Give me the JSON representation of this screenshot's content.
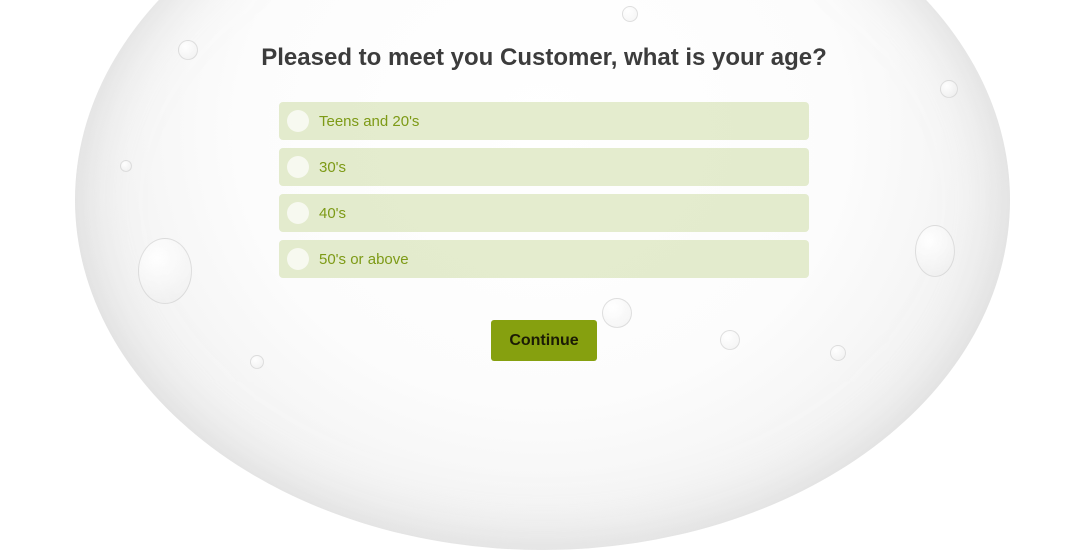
{
  "question": {
    "title": "Pleased to meet you Customer, what is your age?"
  },
  "options": [
    {
      "label": "Teens and 20's"
    },
    {
      "label": "30's"
    },
    {
      "label": "40's"
    },
    {
      "label": "50's or above"
    }
  ],
  "actions": {
    "continue_label": "Continue"
  },
  "colors": {
    "option_background": "#d4e0b0",
    "option_text": "#7d9a16",
    "button_background": "#86a00f",
    "title_text": "#3c3c3c"
  }
}
